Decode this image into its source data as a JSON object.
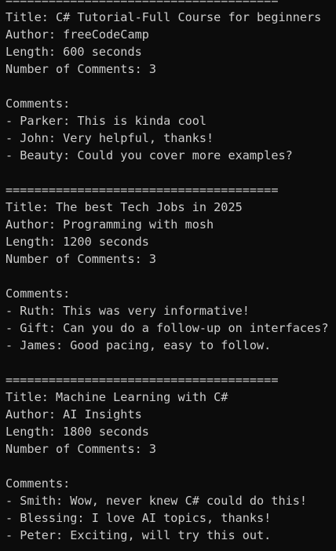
{
  "separator": "======================================",
  "videos": [
    {
      "title_line": "Title: C# Tutorial-Full Course for beginners",
      "author_line": "Author: freeCodeCamp",
      "length_line": "Length: 600 seconds",
      "comment_count_line": "Number of Comments: 3",
      "comments_header": "Comments:",
      "comments": [
        "- Parker: This is kinda cool",
        "- John: Very helpful, thanks!",
        "- Beauty: Could you cover more examples?"
      ]
    },
    {
      "title_line": "Title: The best Tech Jobs in 2025",
      "author_line": "Author: Programming with mosh",
      "length_line": "Length: 1200 seconds",
      "comment_count_line": "Number of Comments: 3",
      "comments_header": "Comments:",
      "comments": [
        "- Ruth: This was very informative!",
        "- Gift: Can you do a follow-up on interfaces?",
        "- James: Good pacing, easy to follow."
      ]
    },
    {
      "title_line": "Title: Machine Learning with C#",
      "author_line": "Author: AI Insights",
      "length_line": "Length: 1800 seconds",
      "comment_count_line": "Number of Comments: 3",
      "comments_header": "Comments:",
      "comments": [
        "- Smith: Wow, never knew C# could do this!",
        "- Blessing: I love AI topics, thanks!",
        "- Peter: Exciting, will try this out."
      ]
    }
  ]
}
